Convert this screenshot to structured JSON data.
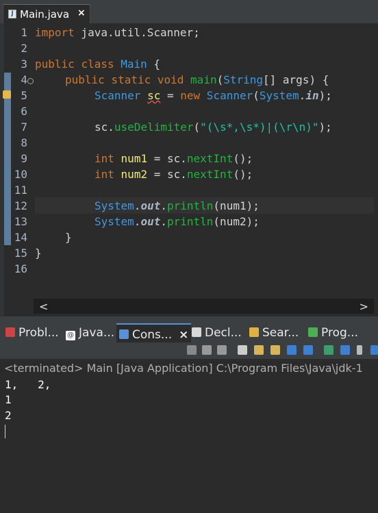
{
  "editor_tab": {
    "label": "Main.java",
    "close": "×",
    "icon": "java-file-icon"
  },
  "line_numbers": [
    "1",
    "2",
    "3",
    "4",
    "5",
    "6",
    "7",
    "8",
    "9",
    "10",
    "11",
    "12",
    "13",
    "14",
    "15",
    "16"
  ],
  "code": {
    "l1": [
      "import",
      " java.util.Scanner;"
    ],
    "l3": [
      "public",
      " ",
      "class",
      " ",
      "Main",
      " {"
    ],
    "l4": [
      "public",
      " ",
      "static",
      " ",
      "void",
      " ",
      "main",
      "(",
      "String",
      "[] args) {"
    ],
    "l5": [
      "Scanner",
      " ",
      "sc",
      " = ",
      "new",
      " ",
      "Scanner",
      "(",
      "System",
      ".",
      "in",
      ");"
    ],
    "l7": [
      "sc",
      ".",
      "useDelimiter",
      "(",
      "\"(\\s*,\\s*)|(\\r\\n)\"",
      ");"
    ],
    "l9": [
      "int",
      " ",
      "num1",
      " = ",
      "sc",
      ".",
      "nextInt",
      "();"
    ],
    "l10": [
      "int",
      " ",
      "num2",
      " = ",
      "sc",
      ".",
      "nextInt",
      "();"
    ],
    "l12": [
      "System",
      ".",
      "out",
      ".",
      "println",
      "(num1);"
    ],
    "l13": [
      "System",
      ".",
      "out",
      ".",
      "println",
      "(num2);"
    ],
    "l14": [
      "}"
    ],
    "l15": [
      "}"
    ]
  },
  "hscroll": {
    "left": "<",
    "right": ">"
  },
  "views": {
    "problems": "Probl...",
    "javadoc": "Java...",
    "console": "Cons...",
    "console_close": "×",
    "declaration": "Decl...",
    "search": "Sear...",
    "progress": "Prog..."
  },
  "console": {
    "status": "<terminated> Main [Java Application] C:\\Program Files\\Java\\jdk-1",
    "lines": [
      "1,   2,",
      "1",
      "2"
    ]
  },
  "colors": {
    "keyword": "#cc7832",
    "class": "#3e9ae4",
    "string": "#17c6a3",
    "method": "#1eb540",
    "variable": "#f3ec79"
  }
}
